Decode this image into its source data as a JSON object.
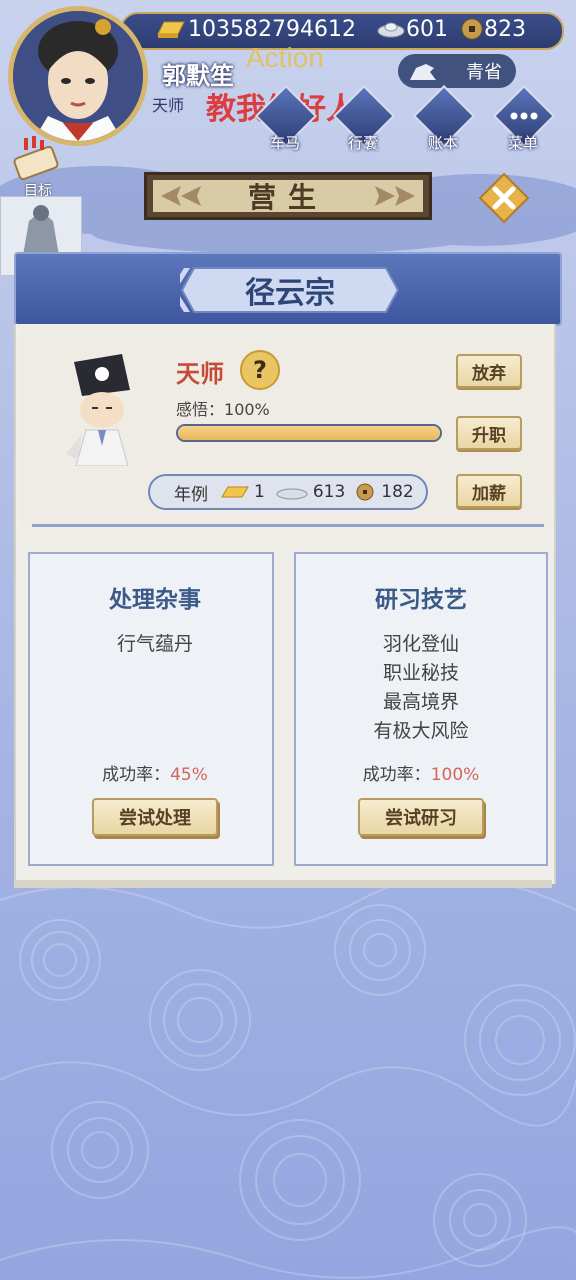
{
  "resources": {
    "gold": "103582794612",
    "silver": "601",
    "copper": "823"
  },
  "player": {
    "name": "郭默笙",
    "title": "天师",
    "region": "青省"
  },
  "overlay": {
    "action": "Action",
    "teach": "教我做好人"
  },
  "nav": [
    {
      "label": "车马",
      "icon": "carriage-icon"
    },
    {
      "label": "行囊",
      "icon": "bag-icon"
    },
    {
      "label": "账本",
      "icon": "ledger-icon"
    },
    {
      "label": "菜单",
      "icon": "menu-dots-icon"
    }
  ],
  "target_label": "目标",
  "banner": {
    "title": "营生"
  },
  "sect": {
    "name": "径云宗"
  },
  "profile": {
    "job": "天师",
    "help": "?",
    "insight_label": "感悟：",
    "insight_value": "100%",
    "insight_progress": 1.0,
    "salary_label": "年例",
    "salary_gold": "1",
    "salary_silver": "613",
    "salary_copper": "182",
    "buttons": {
      "abandon": "放弃",
      "promote": "升职",
      "raise": "加薪"
    }
  },
  "cards": [
    {
      "title": "处理杂事",
      "lines": [
        "行气蕴丹"
      ],
      "rate_label": "成功率：",
      "rate": "45%",
      "button": "尝试处理"
    },
    {
      "title": "研习技艺",
      "lines": [
        "羽化登仙",
        "职业秘技",
        "最高境界",
        "有极大风险"
      ],
      "rate_label": "成功率：",
      "rate": "100%",
      "button": "尝试研习"
    }
  ],
  "colors": {
    "accent_gold": "#e9c661",
    "title_blue": "#3b5a8a",
    "rate_red": "#d4655b",
    "job_red": "#c74b3b"
  }
}
